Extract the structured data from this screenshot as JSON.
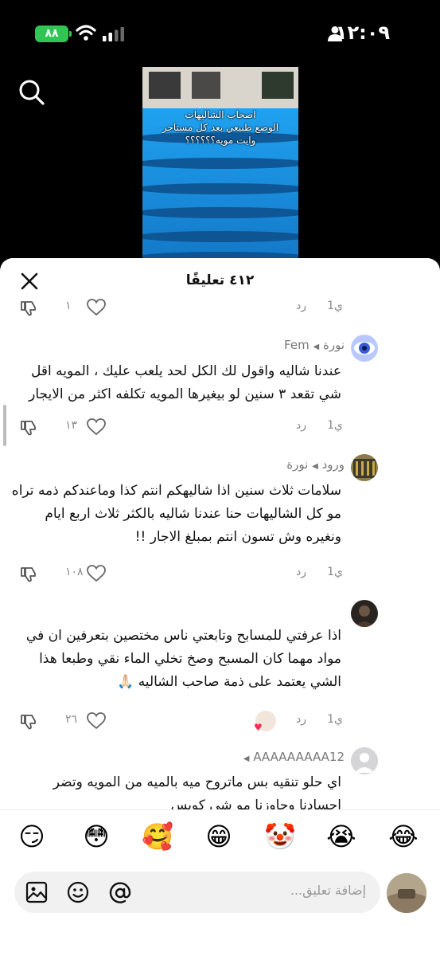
{
  "status": {
    "battery": "٨٨",
    "time": "١٢:٠٩"
  },
  "video": {
    "caption_line1": "اصحاب الشاليهات",
    "caption_line2": "الوضع طبيعي بعد كل مستاجر",
    "caption_line3": "وايت مويه؟؟؟؟؟؟"
  },
  "sheet": {
    "count_label": "٤١٢ تعليقًا"
  },
  "top_actions": {
    "ago": "1ي",
    "reply": "رد",
    "likes": "١"
  },
  "comments": [
    {
      "author": "نورة",
      "reply_to": "Fem",
      "text": "عندنا شاليه واقول لك الكل لحد يلعب عليك ، المويه اقل شي تقعد ٣ سنين لو بيغيرها المويه تكلفه اكثر من الايجار",
      "ago": "1ي",
      "reply": "رد",
      "likes": "١٣"
    },
    {
      "author": "ورود",
      "reply_to": "نورة",
      "text": "سلامات ثلاث سنين اذا شاليهكم انتم كذا وماعندكم ذمه تراه مو كل الشاليهات حنا عندنا شاليه بالكثر ثلاث اربع ايام ونغيره وش تسون انتم بمبلغ الاجار !!",
      "ago": "1ي",
      "reply": "رد",
      "likes": "١٠٨"
    },
    {
      "author": "",
      "reply_to": "",
      "text": "اذا عرفتي للمسابح وتابعتي ناس مختصين بتعرفين ان في مواد مهما كان المسبح وصخ تخلي الماء نقي وطبعا هذا الشي يعتمد على ذمة صاحب الشاليه 🙏🏻",
      "ago": "1ي",
      "reply": "رد",
      "likes": "٢٦"
    },
    {
      "author": "AAAAAAAAA12",
      "reply_to": "",
      "text": "اي حلو تنقيه بس ماتروح ميه بالميه من المويه وتضر اجسادنا وحاوزنا مو شي كويس",
      "ago": "",
      "reply": "",
      "likes": ""
    }
  ],
  "emojis": [
    "😂",
    "😭",
    "🤡",
    "😁",
    "🥰",
    "😳",
    "😏"
  ],
  "input": {
    "placeholder": "إضافة تعليق..."
  }
}
